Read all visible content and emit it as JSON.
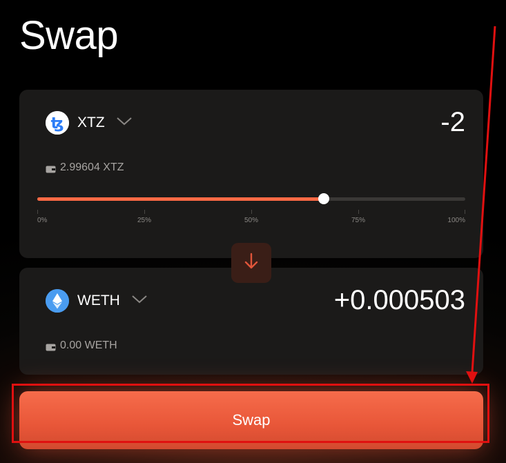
{
  "page": {
    "title": "Swap"
  },
  "from": {
    "symbol": "XTZ",
    "amount": "-2",
    "balance": "2.99604 XTZ",
    "icon": "tezos-icon",
    "slider": {
      "value_percent": 67,
      "ticks": [
        "0%",
        "25%",
        "50%",
        "75%",
        "100%"
      ]
    }
  },
  "to": {
    "symbol": "WETH",
    "amount": "+0.000503",
    "balance": "0.00 WETH",
    "icon": "ethereum-icon"
  },
  "action": {
    "swap_label": "Swap"
  },
  "colors": {
    "accent": "#ff6a45",
    "annotation": "#e01010"
  }
}
